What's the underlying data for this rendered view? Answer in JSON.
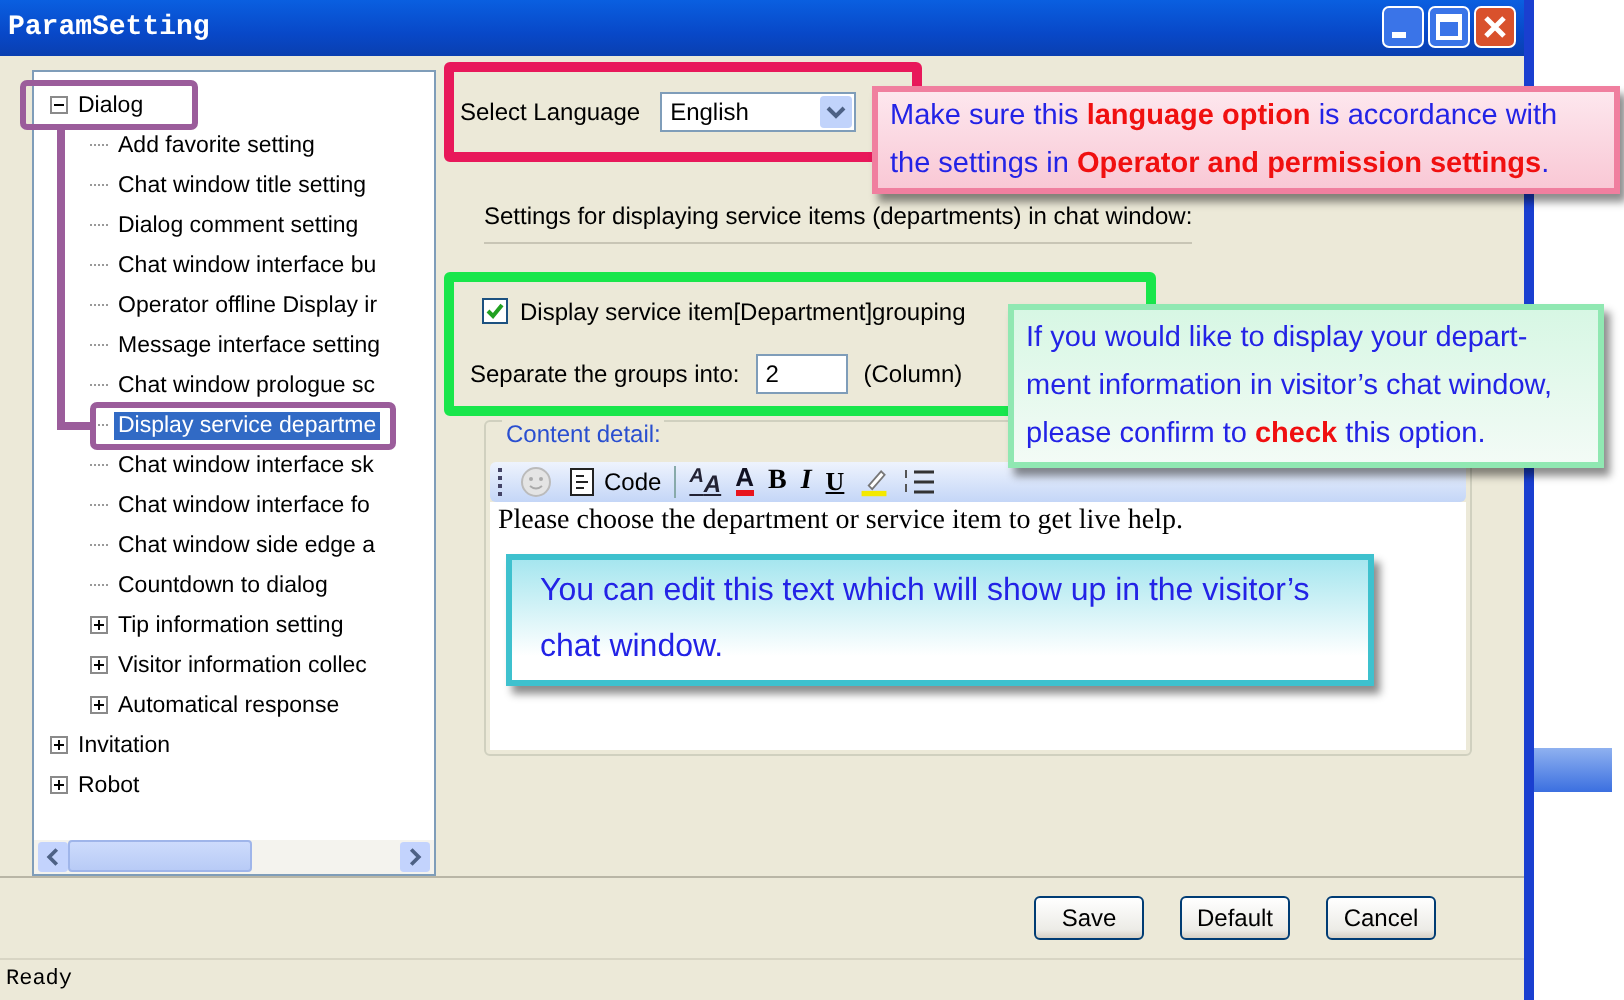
{
  "window": {
    "title": "ParamSetting"
  },
  "tree": [
    {
      "label": "Dialog",
      "expanded": true,
      "selected": false,
      "children": [
        {
          "label": "Add favorite setting",
          "selected": false
        },
        {
          "label": "Chat window title setting",
          "selected": false
        },
        {
          "label": "Dialog comment setting",
          "selected": false
        },
        {
          "label": "Chat window interface bu",
          "selected": false
        },
        {
          "label": "Operator offline Display ir",
          "selected": false
        },
        {
          "label": "Message interface setting",
          "selected": false
        },
        {
          "label": "Chat window prologue sc",
          "selected": false
        },
        {
          "label": "Display service departme",
          "selected": true
        },
        {
          "label": "Chat window interface sk",
          "selected": false
        },
        {
          "label": "Chat window interface fo",
          "selected": false
        },
        {
          "label": "Chat window side edge a",
          "selected": false
        },
        {
          "label": "Countdown to dialog",
          "selected": false
        },
        {
          "label": "Tip information setting",
          "expanded": false,
          "selected": false
        },
        {
          "label": "Visitor information collec",
          "expanded": false,
          "selected": false
        },
        {
          "label": "Automatical response",
          "expanded": false,
          "selected": false
        }
      ]
    },
    {
      "label": "Invitation",
      "expanded": false,
      "selected": false
    },
    {
      "label": "Robot",
      "expanded": false,
      "selected": false
    }
  ],
  "language": {
    "label": "Select Language",
    "value": "English"
  },
  "settings_label": "Settings for displaying service items (departments) in chat window:",
  "grouping": {
    "label": "Display service item[Department]grouping",
    "checked": true
  },
  "columns": {
    "label": "Separate the groups into:",
    "value": "2",
    "unit": "(Column)"
  },
  "content": {
    "legend": "Content detail:",
    "toolbar": [
      {
        "kind": "smiley"
      },
      {
        "kind": "code",
        "label": "Code"
      },
      {
        "kind": "font-size",
        "label": "$^{A}$A"
      },
      {
        "kind": "font-color",
        "label": "A"
      },
      {
        "kind": "bold",
        "label": "B"
      },
      {
        "kind": "italic",
        "label": "I"
      },
      {
        "kind": "underline",
        "label": "U"
      },
      {
        "kind": "highlight"
      },
      {
        "kind": "list"
      }
    ],
    "text": "Please choose the department or service item to get live help."
  },
  "buttons": [
    "Save",
    "Default",
    "Cancel"
  ],
  "status_bar": "Ready",
  "callouts": [
    {
      "kind": "pink",
      "text": "Make sure this **language option** is accordance with the settings in **Operator and permission settings**."
    },
    {
      "kind": "green",
      "text": "If you would like to display your depart-ment information in visitor’s chat window, please confirm to **check** this option."
    },
    {
      "kind": "cyan",
      "text": "You can edit this text which will show up in the visitor’s chat window."
    }
  ]
}
